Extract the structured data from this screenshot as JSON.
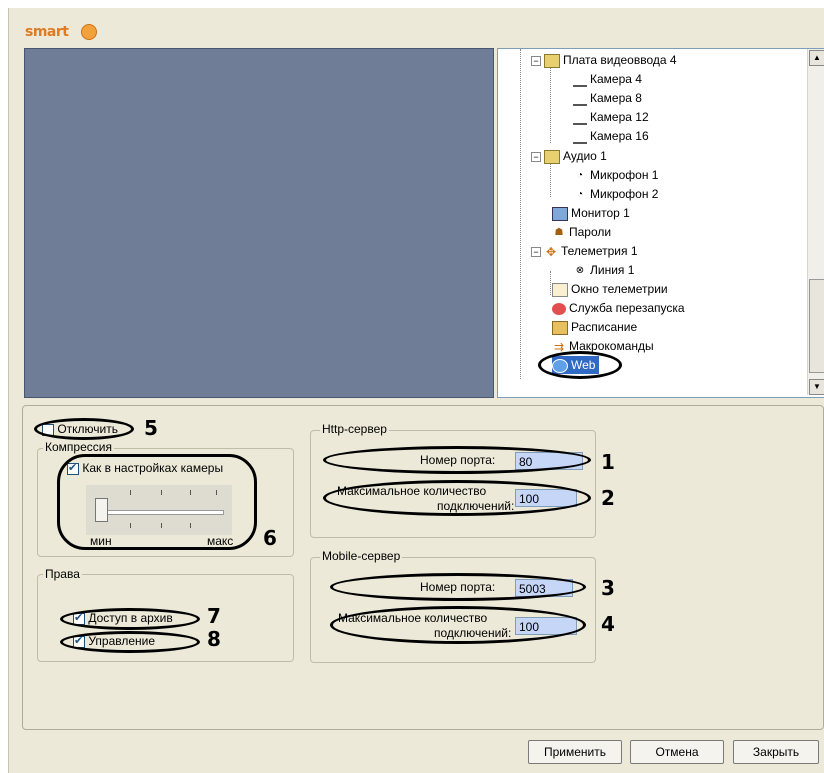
{
  "logo": {
    "text": "smart"
  },
  "tree": {
    "items": [
      {
        "label": "Плата видеоввода 4",
        "icon": "capture-board-icon"
      },
      {
        "label": "Камера 4",
        "icon": "camera-icon"
      },
      {
        "label": "Камера 8",
        "icon": "camera-icon"
      },
      {
        "label": "Камера 12",
        "icon": "camera-icon"
      },
      {
        "label": "Камера 16",
        "icon": "camera-icon"
      },
      {
        "label": "Аудио 1",
        "icon": "audio-board-icon"
      },
      {
        "label": "Микрофон 1",
        "icon": "microphone-icon"
      },
      {
        "label": "Микрофон 2",
        "icon": "microphone-icon"
      },
      {
        "label": "Монитор 1",
        "icon": "monitor-icon"
      },
      {
        "label": "Пароли",
        "icon": "users-icon"
      },
      {
        "label": "Телеметрия 1",
        "icon": "telemetry-icon"
      },
      {
        "label": "Линия 1",
        "icon": "line-icon"
      },
      {
        "label": "Окно телеметрии",
        "icon": "telemetry-window-icon"
      },
      {
        "label": "Служба перезапуска",
        "icon": "restart-service-icon"
      },
      {
        "label": "Расписание",
        "icon": "schedule-icon"
      },
      {
        "label": "Макрокоманды",
        "icon": "macro-icon"
      },
      {
        "label": "Web",
        "icon": "web-icon",
        "selected": true
      }
    ]
  },
  "settings": {
    "disable_label": "Отключить",
    "compression": {
      "title": "Компрессия",
      "same_as_camera_label": "Как в настройках камеры",
      "min_label": "мин",
      "max_label": "макс",
      "level": 0
    },
    "rights": {
      "title": "Права",
      "archive_access_label": "Доступ в архив",
      "control_label": "Управление"
    },
    "http_server": {
      "title": "Http-сервер",
      "port_label": "Номер порта:",
      "port_value": "80",
      "max_conn_label_1": "Максимальное количество",
      "max_conn_label_2": "подключений:",
      "max_conn_value": "100"
    },
    "mobile_server": {
      "title": "Mobile-сервер",
      "port_label": "Номер порта:",
      "port_value": "5003",
      "max_conn_label_1": "Максимальное количество",
      "max_conn_label_2": "подключений:",
      "max_conn_value": "100"
    }
  },
  "callouts": [
    "1",
    "2",
    "3",
    "4",
    "5",
    "6",
    "7",
    "8"
  ],
  "buttons": {
    "apply": "Применить",
    "cancel": "Отмена",
    "close": "Закрыть"
  }
}
